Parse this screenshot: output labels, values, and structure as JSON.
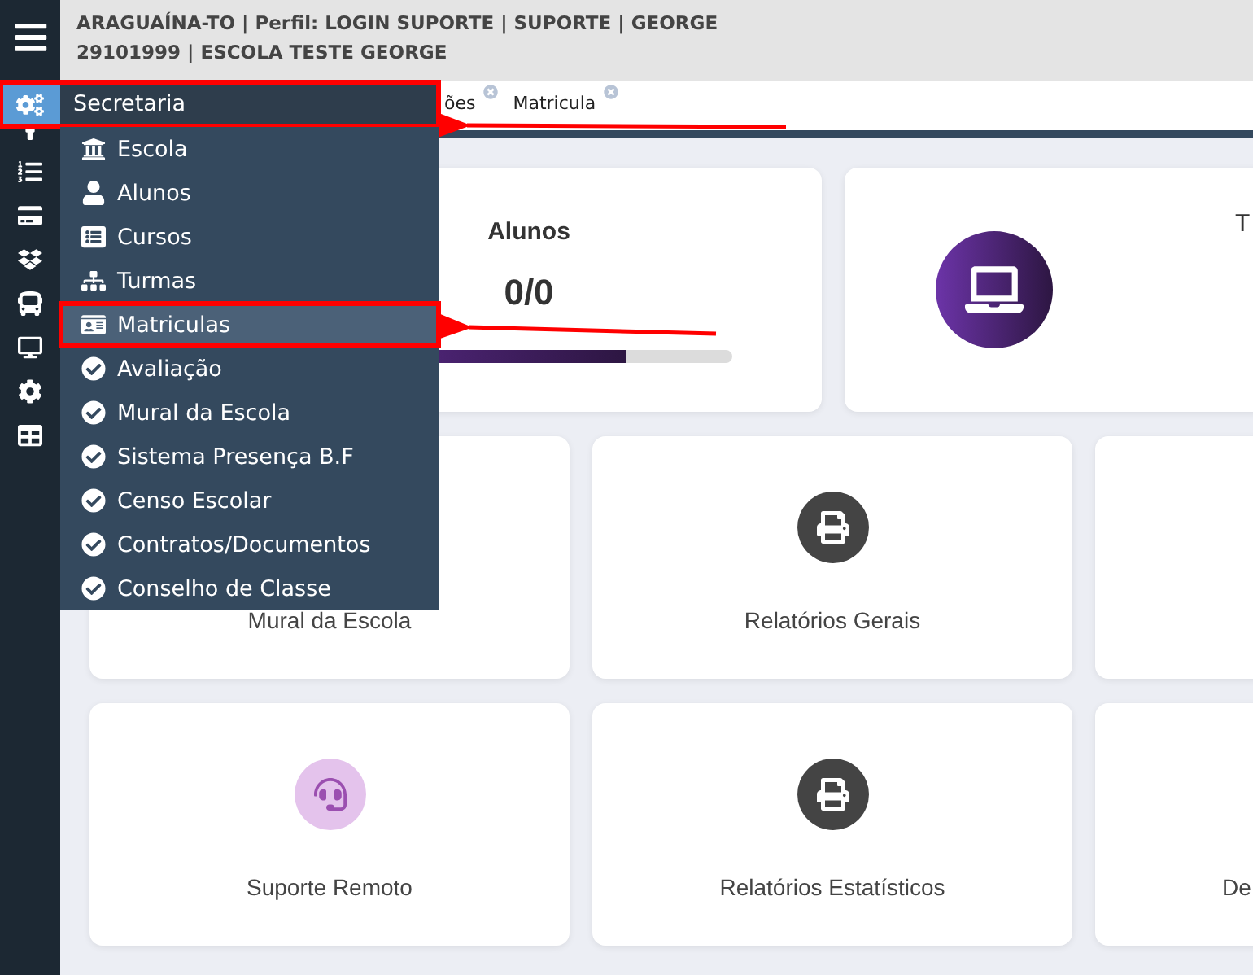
{
  "header": {
    "lines": [
      "ARAGUAÍNA-TO | Perfil: LOGIN SUPORTE | SUPORTE | GEORGE",
      "29101999 | ESCOLA TESTE GEORGE"
    ]
  },
  "tabs": [
    {
      "label": "ões"
    },
    {
      "label": "Matricula"
    }
  ],
  "menu": {
    "title": "Secretaria",
    "highlighted": true,
    "items": [
      {
        "label": "Escola",
        "highlighted": false
      },
      {
        "label": "Alunos",
        "highlighted": false
      },
      {
        "label": "Cursos",
        "highlighted": false
      },
      {
        "label": "Turmas",
        "highlighted": false
      },
      {
        "label": "Matriculas",
        "highlighted": true
      },
      {
        "label": "Avaliação",
        "highlighted": false
      },
      {
        "label": "Mural da Escola",
        "highlighted": false
      },
      {
        "label": "Sistema Presença B.F",
        "highlighted": false
      },
      {
        "label": "Censo Escolar",
        "highlighted": false
      },
      {
        "label": "Contratos/Documentos",
        "highlighted": false
      },
      {
        "label": "Conselho de Classe",
        "highlighted": false
      }
    ]
  },
  "stats": [
    {
      "kind": "progress",
      "title": "Alunos",
      "value": "0/0",
      "level": 0.74
    },
    {
      "kind": "icon",
      "title": "T"
    }
  ],
  "shortcuts": [
    {
      "kind": "plain",
      "label": "Mural da Escola"
    },
    {
      "kind": "print",
      "label": "Relatórios Gerais"
    },
    {
      "kind": "plain"
    },
    {
      "kind": "support",
      "label": "Suporte Remoto"
    },
    {
      "kind": "print",
      "label": "Relatórios Estatísticos"
    },
    {
      "kind": "plain",
      "label": "De"
    }
  ]
}
